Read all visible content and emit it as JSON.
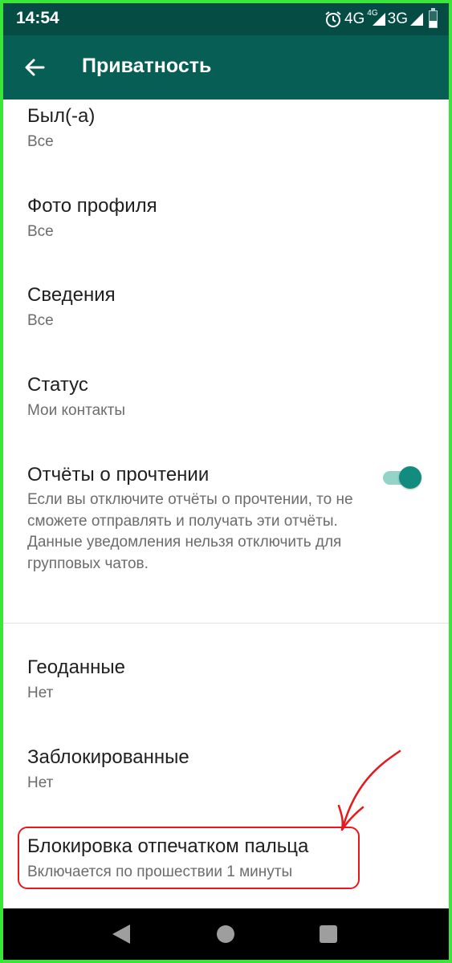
{
  "status_bar": {
    "time": "14:54",
    "alarm_icon": "alarm-icon",
    "net1": "4G",
    "net1_small": "4G",
    "net2": "3G"
  },
  "app_bar": {
    "title": "Приватность",
    "back_icon": "arrow-left-icon",
    "color": "#075e54"
  },
  "settings": {
    "last_seen": {
      "title": "Был(-а)",
      "value": "Все"
    },
    "profile_photo": {
      "title": "Фото профиля",
      "value": "Все"
    },
    "about": {
      "title": "Сведения",
      "value": "Все"
    },
    "status": {
      "title": "Статус",
      "value": "Мои контакты"
    },
    "read_receipts": {
      "title": "Отчёты о прочтении",
      "description": "Если вы отключите отчёты о прочтении, то не сможете отправлять и получать эти отчёты. Данные уведомления нельзя отключить для групповых чатов.",
      "enabled": true
    },
    "location": {
      "title": "Геоданные",
      "value": "Нет"
    },
    "blocked": {
      "title": "Заблокированные",
      "value": "Нет"
    },
    "fingerprint": {
      "title": "Блокировка отпечатком пальца",
      "value": "Включается по прошествии 1 минуты"
    }
  },
  "annotation_color": "#e8181c",
  "nav_bar": {
    "back_icon": "nav-back-icon",
    "home_icon": "nav-home-icon",
    "recents_icon": "nav-recents-icon"
  }
}
